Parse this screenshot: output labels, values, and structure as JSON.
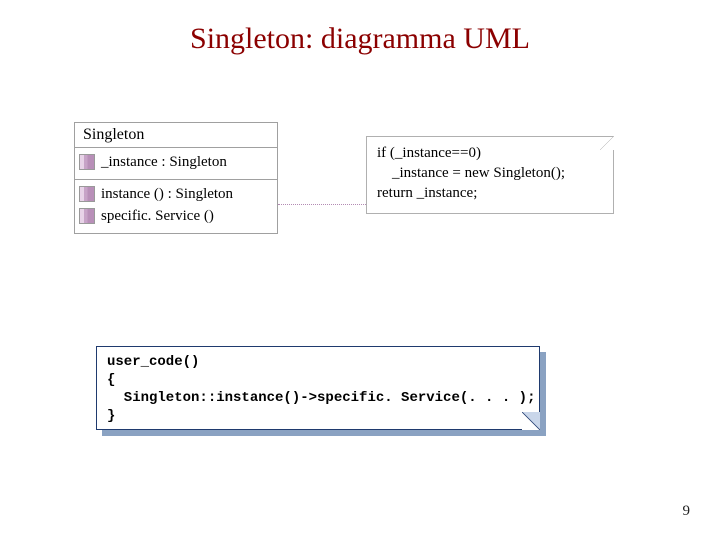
{
  "title": "Singleton: diagramma UML",
  "uml": {
    "class_name": "Singleton",
    "attributes": [
      {
        "text": "_instance : Singleton"
      }
    ],
    "operations": [
      {
        "text": "instance () : Singleton"
      },
      {
        "text": "specific. Service ()"
      }
    ]
  },
  "note": {
    "lines": [
      "if (_instance==0)",
      "    _instance = new Singleton();",
      "return _instance;"
    ]
  },
  "code": {
    "lines": [
      "user_code()",
      "{",
      "  Singleton::instance()->specific. Service(. . . );",
      "}"
    ]
  },
  "page_number": "9"
}
